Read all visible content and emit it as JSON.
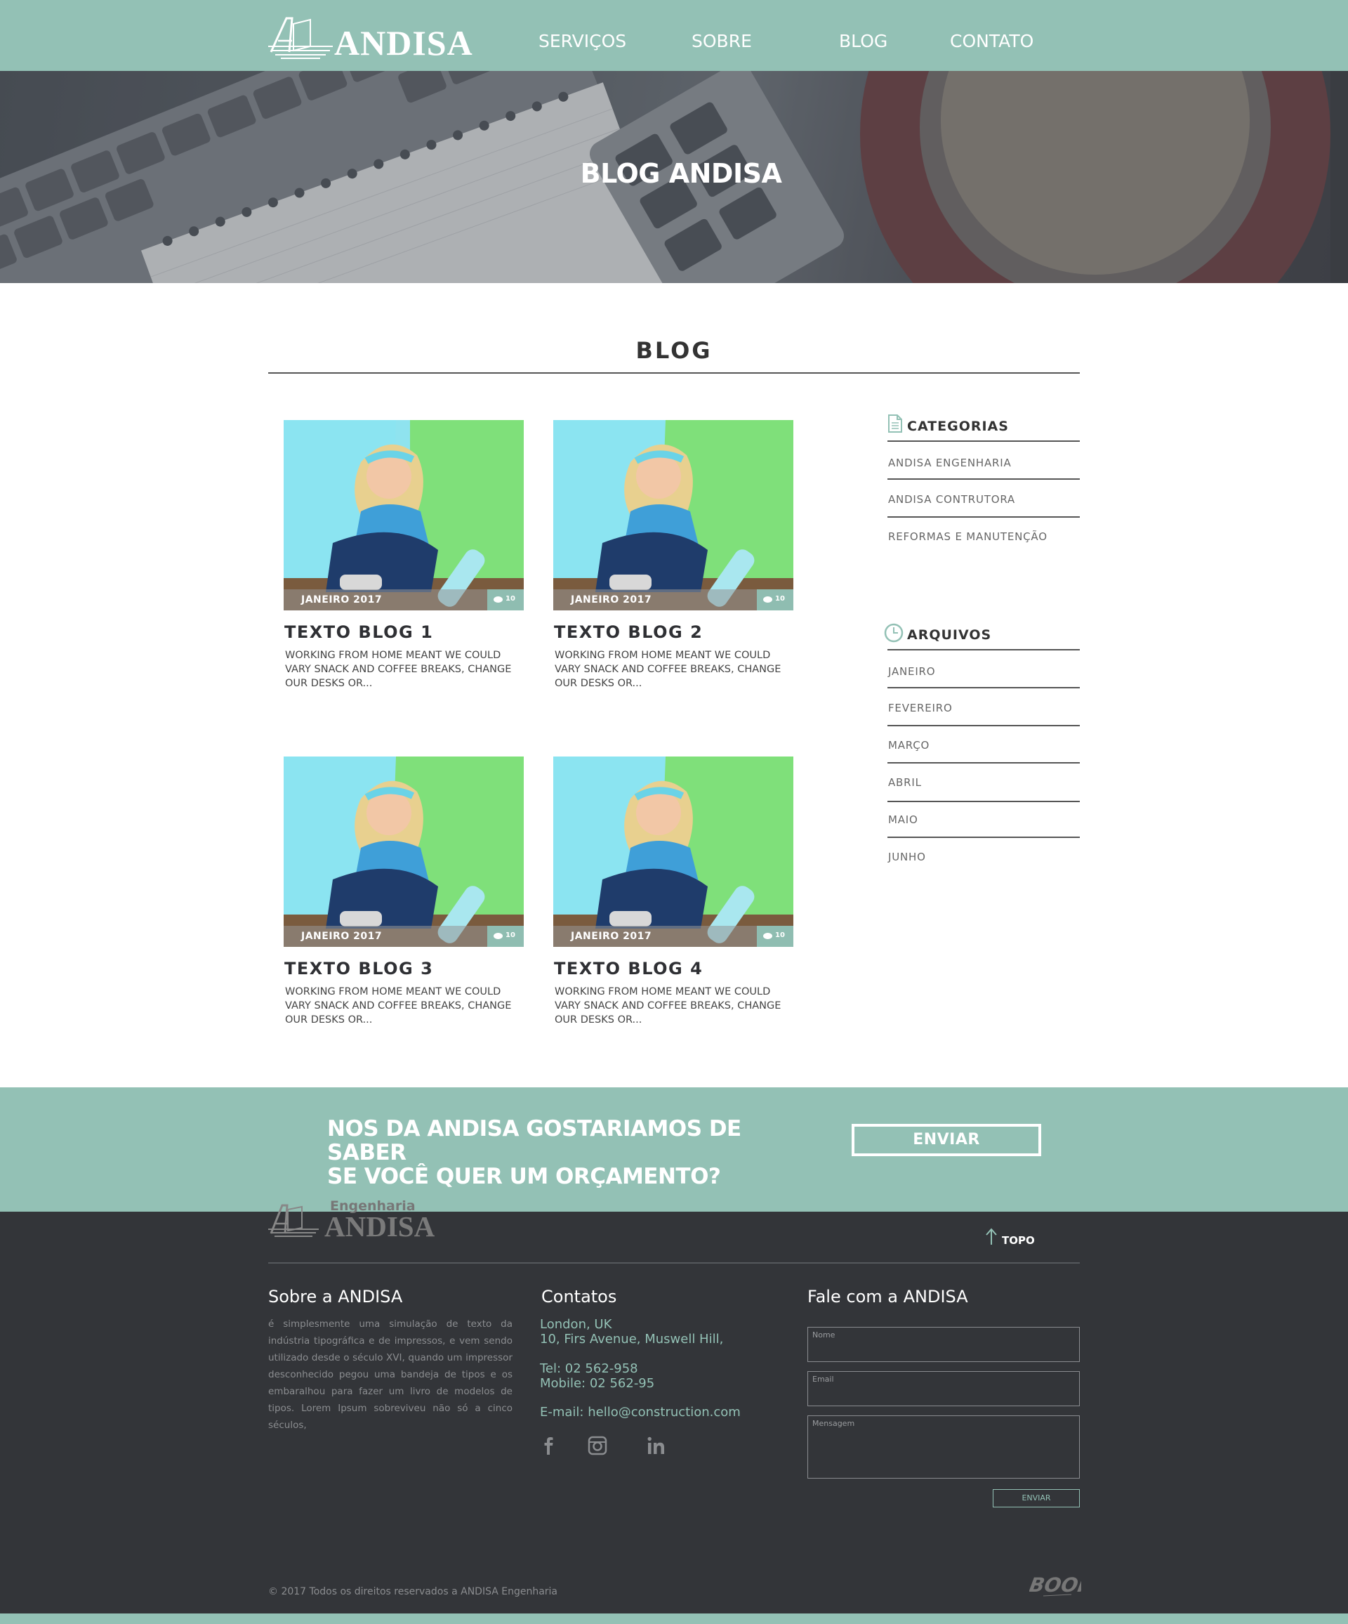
{
  "header": {
    "logo_text": "ANDISA",
    "nav": [
      "SERVIÇOS",
      "SOBRE",
      "BLOG",
      "CONTATO"
    ]
  },
  "hero": {
    "title": "BLOG ANDISA"
  },
  "blog": {
    "title": "BLOG",
    "posts": [
      {
        "date": "JANEIRO 2017",
        "comments": "10",
        "title": "TEXTO BLOG 1",
        "excerpt": "WORKING FROM HOME MEANT WE COULD VARY SNACK AND COFFEE BREAKS, CHANGE OUR DESKS OR..."
      },
      {
        "date": "JANEIRO 2017",
        "comments": "10",
        "title": "TEXTO BLOG 2",
        "excerpt": "WORKING FROM HOME MEANT WE COULD VARY SNACK AND COFFEE BREAKS, CHANGE OUR DESKS OR..."
      },
      {
        "date": "JANEIRO 2017",
        "comments": "10",
        "title": "TEXTO BLOG 3",
        "excerpt": "WORKING FROM HOME MEANT WE COULD VARY SNACK AND COFFEE BREAKS, CHANGE OUR DESKS OR..."
      },
      {
        "date": "JANEIRO 2017",
        "comments": "10",
        "title": "TEXTO BLOG 4",
        "excerpt": "WORKING FROM HOME MEANT WE COULD VARY SNACK AND COFFEE BREAKS, CHANGE OUR DESKS OR..."
      }
    ]
  },
  "sidebar": {
    "categories": {
      "title": "CATEGORIAS",
      "icon": "document-icon",
      "items": [
        "ANDISA ENGENHARIA",
        "ANDISA CONTRUTORA",
        "REFORMAS E MANUTENÇÃO"
      ]
    },
    "archives": {
      "title": "ARQUIVOS",
      "icon": "clock-icon",
      "items": [
        "JANEIRO",
        "FEVEREIRO",
        "MARÇO",
        "ABRIL",
        "MAIO",
        "JUNHO"
      ]
    }
  },
  "cta": {
    "line1": "NOS DA ANDISA GOSTARIAMOS  DE SABER",
    "line2": "SE VOCÊ QUER UM ORÇAMENTO?",
    "button": "ENVIAR"
  },
  "footer": {
    "logo_sub": "Engenharia",
    "logo_text": "ANDISA",
    "topo": "TOPO",
    "about_title": "Sobre a ANDISA",
    "about_text": "é simplesmente uma simulação de texto da indústria tipográfica e de impressos, e vem sendo utilizado desde o século XVI, quando um impressor desconhecido pegou uma bandeja de tipos e os embaralhou para fazer um livro de modelos de tipos. Lorem Ipsum sobreviveu não só a cinco séculos,",
    "contacts_title": "Contatos",
    "address1": "London, UK",
    "address2": "10, Firs Avenue, Muswell Hill,",
    "tel": "Tel: 02 562-958",
    "mobile": "Mobile: 02 562-95",
    "email": "E-mail: hello@construction.com",
    "social": [
      "facebook-icon",
      "instagram-icon",
      "linkedin-icon"
    ],
    "form_title": "Fale com a ANDISA",
    "form": {
      "name": "Nome",
      "email": "Email",
      "message": "Mensagem",
      "send": "ENVIAR"
    },
    "copyright": "© 2017  Todos os direitos reservados a ANDISA Engenharia",
    "credit": "BOOM"
  },
  "colors": {
    "accent": "#93c1b5",
    "footer_bg": "#333539",
    "text_dark": "#2f3034"
  }
}
